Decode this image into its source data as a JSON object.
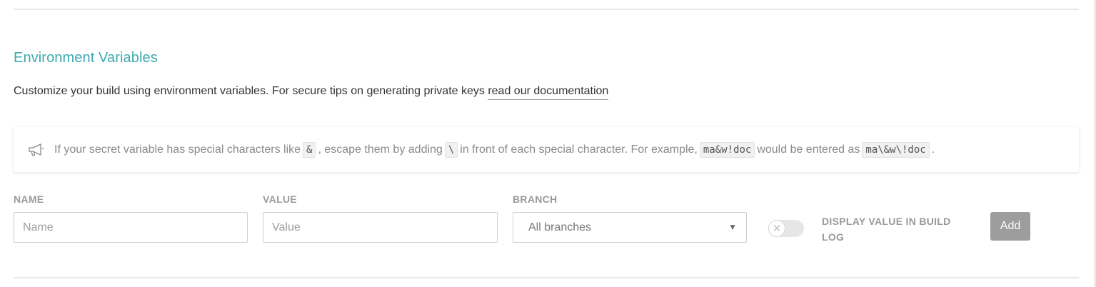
{
  "section": {
    "title": "Environment Variables",
    "intro_text": "Customize your build using environment variables. For secure tips on generating private keys ",
    "intro_link": "read our documentation"
  },
  "notice": {
    "icon": "megaphone-icon",
    "part1": "If your secret variable has special characters like ",
    "code1": "&",
    "part2": ", escape them by adding ",
    "code2": "\\",
    "part3": " in front of each special character. For example, ",
    "code3": "ma&w!doc",
    "part4": " would be entered as ",
    "code4": "ma\\&w\\!doc",
    "part5": "."
  },
  "form": {
    "name_label": "NAME",
    "name_placeholder": "Name",
    "name_value": "",
    "value_label": "VALUE",
    "value_placeholder": "Value",
    "value_value": "",
    "branch_label": "BRANCH",
    "branch_selected": "All branches",
    "branch_caret": "▼",
    "toggle_off_symbol": "✕",
    "toggle_label": "DISPLAY VALUE IN BUILD LOG",
    "add_label": "Add"
  },
  "colors": {
    "accent": "#3eaaaf",
    "button_disabled": "#9d9d9d",
    "label_gray": "#9a9a9a"
  }
}
